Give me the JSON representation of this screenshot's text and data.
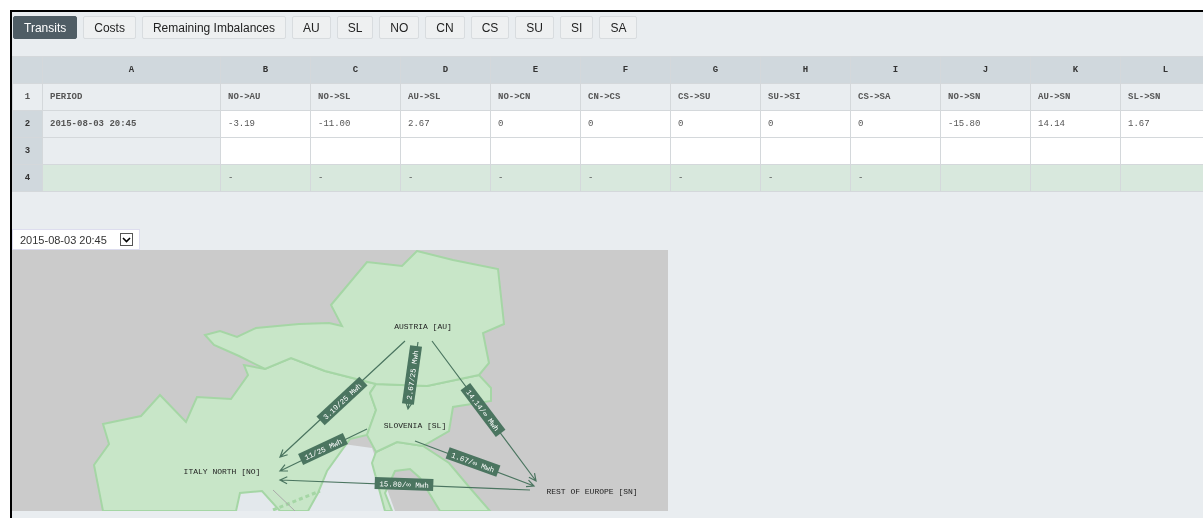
{
  "tabs": [
    {
      "label": "Transits",
      "selected": true
    },
    {
      "label": "Costs",
      "selected": false
    },
    {
      "label": "Remaining Imbalances",
      "selected": false
    },
    {
      "label": "AU",
      "selected": false
    },
    {
      "label": "SL",
      "selected": false
    },
    {
      "label": "NO",
      "selected": false
    },
    {
      "label": "CN",
      "selected": false
    },
    {
      "label": "CS",
      "selected": false
    },
    {
      "label": "SU",
      "selected": false
    },
    {
      "label": "SI",
      "selected": false
    },
    {
      "label": "SA",
      "selected": false
    }
  ],
  "sheet": {
    "column_letters": [
      "A",
      "B",
      "C",
      "D",
      "E",
      "F",
      "G",
      "H",
      "I",
      "J",
      "K",
      "L"
    ],
    "rows": [
      {
        "number": "1",
        "kind": "header",
        "cells": [
          "PERIOD",
          "NO->AU",
          "NO->SL",
          "AU->SL",
          "NO->CN",
          "CN->CS",
          "CS->SU",
          "SU->SI",
          "CS->SA",
          "NO->SN",
          "AU->SN",
          "SL->SN"
        ]
      },
      {
        "number": "2",
        "kind": "data",
        "cells": [
          "2015-08-03 20:45",
          "-3.19",
          "-11.00",
          "2.67",
          "0",
          "0",
          "0",
          "0",
          "0",
          "-15.80",
          "14.14",
          "1.67"
        ]
      },
      {
        "number": "3",
        "kind": "data"
      },
      {
        "number": "4",
        "kind": "check",
        "cells": [
          null,
          "-",
          "-",
          "-",
          "-",
          "-",
          "-",
          "-",
          "-",
          null,
          null,
          null
        ]
      }
    ]
  },
  "period_select": {
    "value": "2015-08-03 20:45"
  },
  "map": {
    "regions": [
      {
        "label": "AUSTRIA [AU]"
      },
      {
        "label": "SLOVENIA [SL]"
      },
      {
        "label": "ITALY NORTH [NO]"
      },
      {
        "label": "REST OF EUROPE [SN]"
      }
    ],
    "flows": [
      {
        "label": "3.19/25 Mwh"
      },
      {
        "label": "2.67/25 Mwh"
      },
      {
        "label": "14.14/∞ Mwh"
      },
      {
        "label": "11/25 Mwh"
      },
      {
        "label": "1.67/∞ Mwh"
      },
      {
        "label": "15.80/∞ Mwh"
      }
    ]
  }
}
